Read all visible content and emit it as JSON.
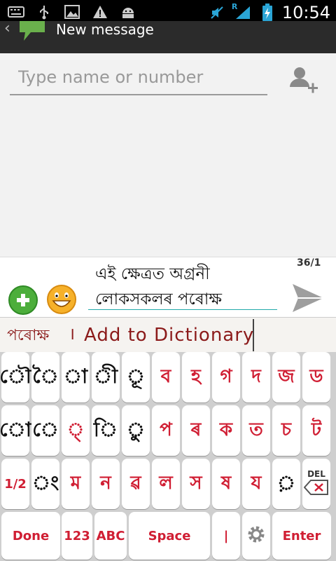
{
  "status_bar": {
    "time": "10:54",
    "signal_letter": "R",
    "icons": [
      "keyboard-icon",
      "usb-icon",
      "image-icon",
      "warning-icon",
      "android-icon",
      "mute-icon",
      "signal-icon",
      "battery-charging-icon"
    ]
  },
  "action_bar": {
    "title": "New message",
    "back_glyph": "‹"
  },
  "recipient": {
    "placeholder": "Type name or number"
  },
  "compose": {
    "message_line1": "এই ক্ষেত্ৰত অগ্ৰনী",
    "message_line2": "লোকসকলৰ পৰোক্ষ",
    "counter": "36/1"
  },
  "suggestion": {
    "word": "পৰোক্ষ",
    "separator": "।",
    "add_label": "Add to Dictionary"
  },
  "keyboard": {
    "row1": [
      "ৌ",
      "ৈ",
      "া",
      "ী",
      "ূ",
      "ব",
      "হ",
      "গ",
      "দ",
      "জ",
      "ড"
    ],
    "row2": [
      "ো",
      "ে",
      "্",
      "ি",
      "ু",
      "প",
      "ৰ",
      "ক",
      "ত",
      "চ",
      "ট"
    ],
    "row3": [
      "1/2",
      "ং",
      "ম",
      "ন",
      "ৱ",
      "ল",
      "স",
      "ষ",
      "য",
      "়",
      "DEL"
    ],
    "row4": [
      "Done",
      "123",
      "ABC",
      "Space",
      "|",
      "⚙",
      "Enter"
    ]
  },
  "colors": {
    "accent_red": "#d01e33",
    "suggest_text": "#8b1a1a",
    "send_arrow": "#9e9e9e"
  }
}
